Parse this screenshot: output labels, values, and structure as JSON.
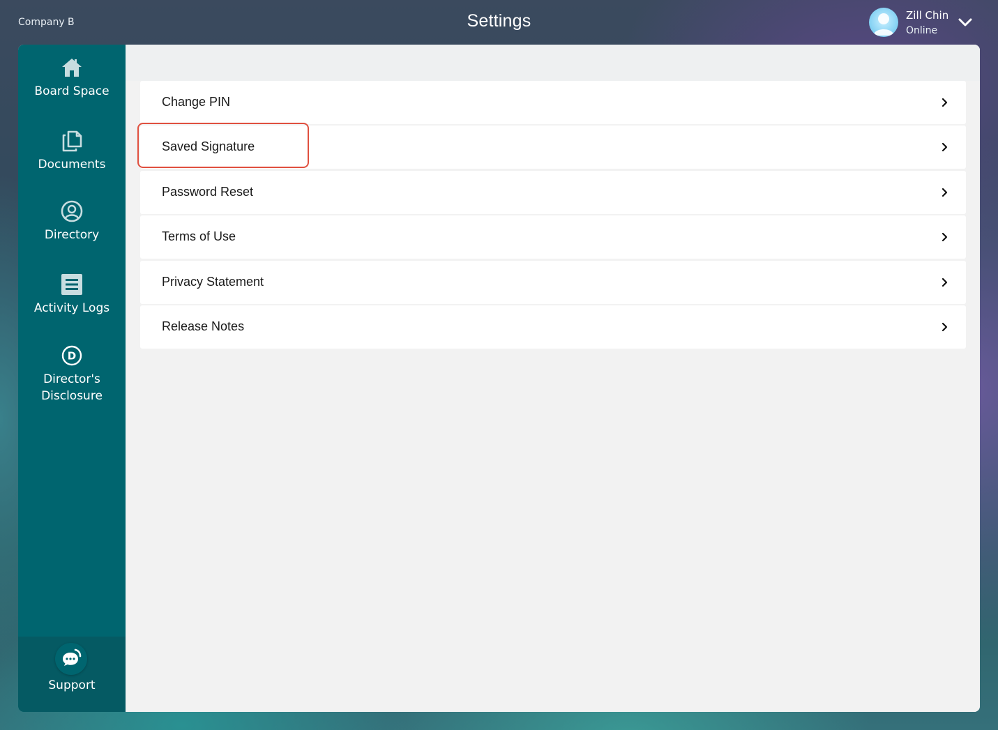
{
  "header": {
    "company": "Company B",
    "title": "Settings",
    "user": {
      "name": "Zill Chin",
      "status": "Online"
    }
  },
  "sidebar": {
    "items": [
      {
        "label": "Board Space",
        "icon": "home-icon"
      },
      {
        "label": "Documents",
        "icon": "documents-icon"
      },
      {
        "label": "Directory",
        "icon": "user-circle-icon"
      },
      {
        "label": "Activity Logs",
        "icon": "list-icon"
      },
      {
        "label": "Director's Disclosure",
        "icon": "d-circle-icon"
      }
    ],
    "support": {
      "label": "Support",
      "icon": "chat-icon"
    }
  },
  "settings": {
    "rows": [
      {
        "label": "Change PIN"
      },
      {
        "label": "Saved Signature"
      },
      {
        "label": "Password Reset"
      },
      {
        "label": "Terms of Use"
      },
      {
        "label": "Privacy Statement"
      },
      {
        "label": "Release Notes"
      }
    ]
  },
  "colors": {
    "sidebar": "#00656f",
    "highlight": "#e0503f"
  }
}
